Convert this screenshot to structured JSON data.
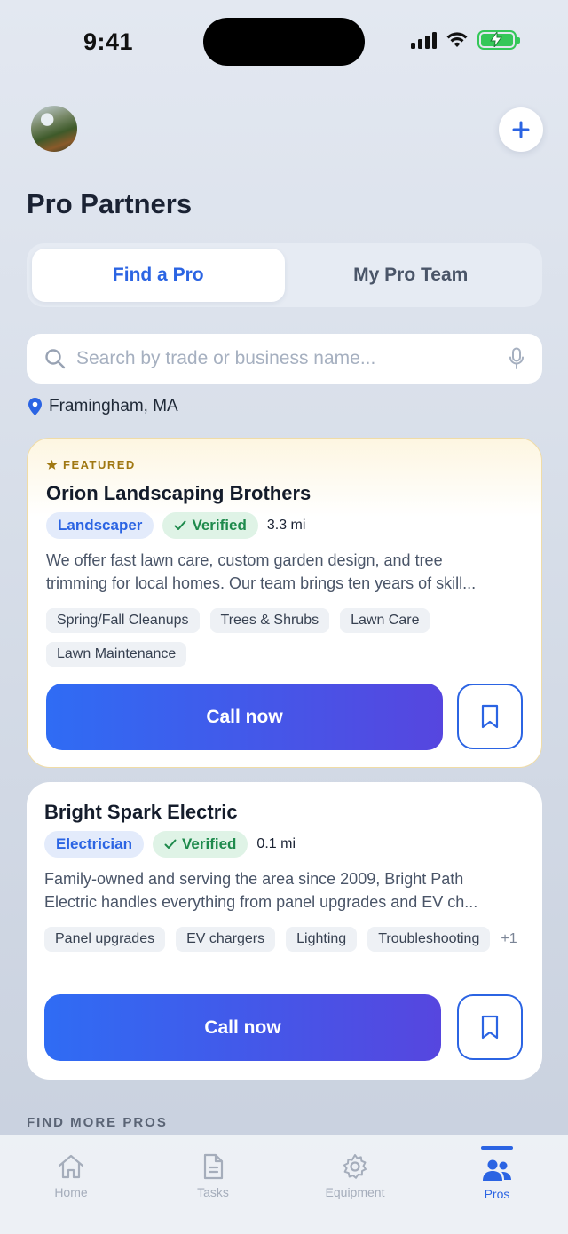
{
  "status_bar": {
    "time": "9:41"
  },
  "header": {
    "title": "Pro Partners"
  },
  "segments": [
    {
      "label": "Find a Pro",
      "active": true
    },
    {
      "label": "My Pro Team",
      "active": false
    }
  ],
  "search": {
    "placeholder": "Search by trade or business name...",
    "value": ""
  },
  "location": "Framingham, MA",
  "cards": [
    {
      "featured_label": "FEATURED",
      "name": "Orion Landscaping Brothers",
      "trade": "Landscaper",
      "verified": "Verified",
      "distance": "3.3 mi",
      "description": [
        "We offer fast lawn care, custom garden design, and tree",
        "trimming for local homes. Our team brings ten years of skill..."
      ],
      "tags": [
        "Spring/Fall Cleanups",
        "Trees & Shrubs",
        "Lawn Care",
        "Lawn Maintenance"
      ],
      "call_label": "Call now"
    },
    {
      "name": "Bright Spark Electric",
      "trade": "Electrician",
      "verified": "Verified",
      "distance": "0.1 mi",
      "description": [
        "Family-owned and serving the area since 2009, Bright Path",
        "Electric handles everything from panel upgrades and EV ch..."
      ],
      "tags": [
        "Panel upgrades",
        "EV chargers",
        "Lighting",
        "Troubleshooting"
      ],
      "more_tags": "+1",
      "call_label": "Call now"
    }
  ],
  "section_label": "FIND MORE PROS",
  "tabs": [
    {
      "label": "Home",
      "icon": "home-icon"
    },
    {
      "label": "Tasks",
      "icon": "document-icon"
    },
    {
      "label": "Equipment",
      "icon": "gear-icon"
    },
    {
      "label": "Pros",
      "icon": "people-icon",
      "active": true
    }
  ],
  "colors": {
    "accent": "#2b64e3",
    "verified": "#1e8a4c",
    "featured": "#a07812"
  }
}
